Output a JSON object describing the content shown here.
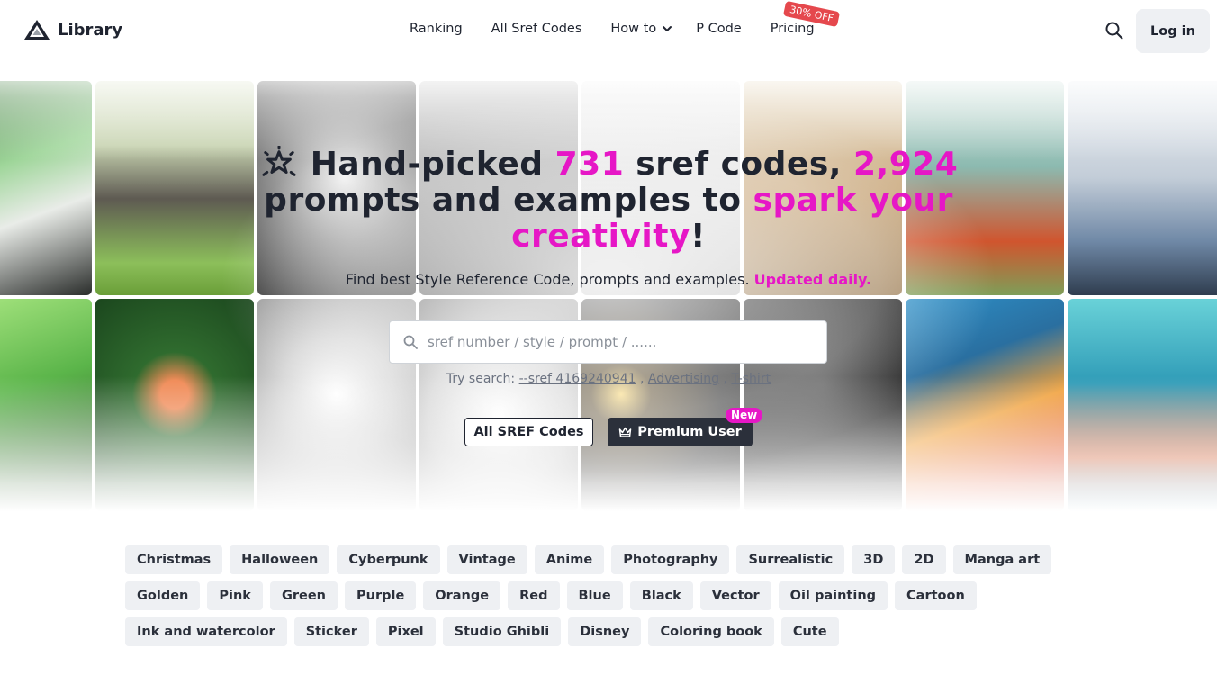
{
  "header": {
    "logo_text": "Library",
    "nav": [
      {
        "label": "Ranking"
      },
      {
        "label": "All Sref Codes"
      },
      {
        "label": "How to"
      },
      {
        "label": "P Code"
      },
      {
        "label": "Pricing",
        "badge": "30% OFF"
      }
    ],
    "login_label": "Log in"
  },
  "hero": {
    "headline": {
      "part1": "Hand-picked ",
      "sref_count": "731",
      "part2": " sref codes, ",
      "prompt_count": "2,924",
      "part3": " prompts and examples to ",
      "highlight": "spark your creativity",
      "part4": "!"
    },
    "subline": {
      "text": "Find best Style Reference Code, prompts and examples. ",
      "highlight": "Updated daily."
    },
    "search": {
      "placeholder": "sref number / style / prompt / ......",
      "value": ""
    },
    "try_search": {
      "label": "Try search: ",
      "links": [
        "--sref 4169240941",
        "Advertising",
        "T-shirt"
      ],
      "separator": " , "
    },
    "buttons": {
      "all_sref": "All SREF Codes",
      "premium": "Premium User",
      "premium_badge": "New"
    }
  },
  "tags": [
    [
      "Christmas",
      "Halloween",
      "Cyberpunk",
      "Vintage",
      "Anime",
      "Photography",
      "Surrealistic",
      "3D",
      "2D",
      "Manga art"
    ],
    [
      "Golden",
      "Pink",
      "Green",
      "Purple",
      "Orange",
      "Red",
      "Blue",
      "Black",
      "Vector",
      "Oil painting",
      "Cartoon"
    ],
    [
      "Ink and watercolor",
      "Sticker",
      "Pixel",
      "Studio Ghibli",
      "Disney",
      "Coloring book",
      "Cute"
    ]
  ],
  "colors": {
    "accent": "#e617c6",
    "text": "#1f2430",
    "badge_red": "#e5484d",
    "tag_bg": "#eef0f3"
  },
  "icons": {
    "logo": "pyramid-logo-icon",
    "search": "search-icon",
    "chevron": "chevron-down-icon",
    "spark": "sparkle-icon",
    "crown": "crown-icon"
  }
}
